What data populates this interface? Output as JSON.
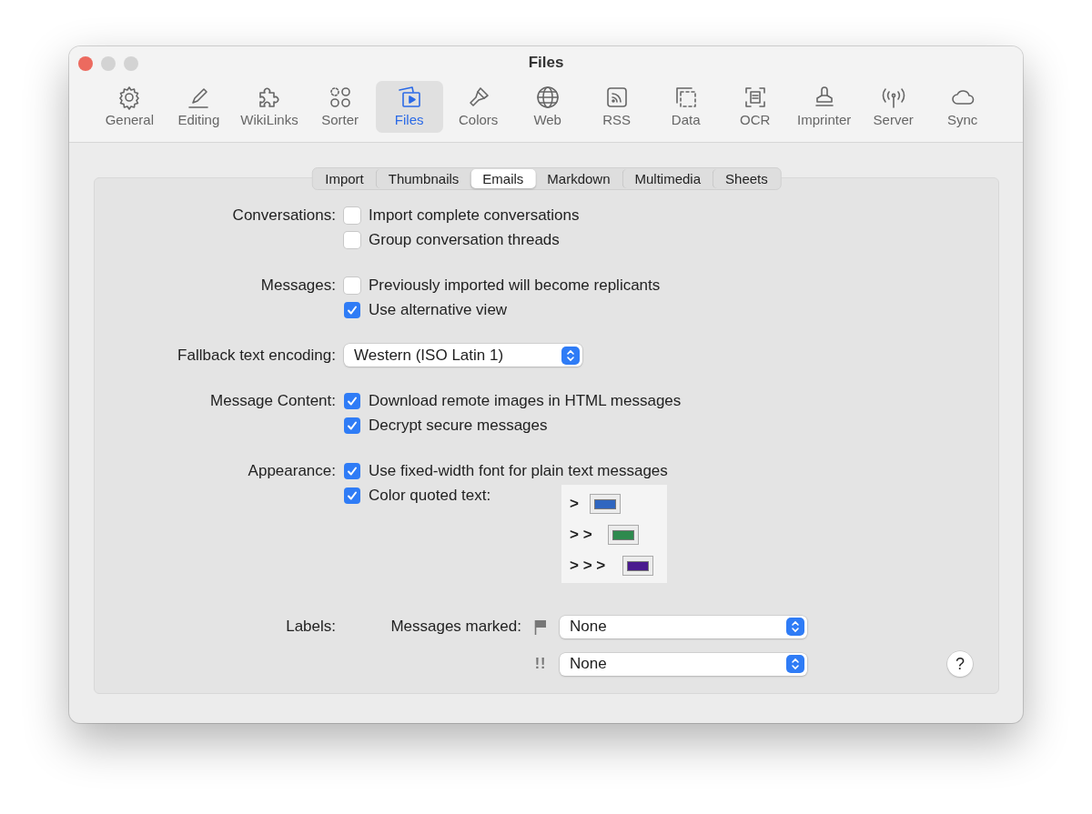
{
  "window": {
    "title": "Files"
  },
  "toolbar": [
    {
      "label": "General",
      "selected": false
    },
    {
      "label": "Editing",
      "selected": false
    },
    {
      "label": "WikiLinks",
      "selected": false
    },
    {
      "label": "Sorter",
      "selected": false
    },
    {
      "label": "Files",
      "selected": true
    },
    {
      "label": "Colors",
      "selected": false
    },
    {
      "label": "Web",
      "selected": false
    },
    {
      "label": "RSS",
      "selected": false
    },
    {
      "label": "Data",
      "selected": false
    },
    {
      "label": "OCR",
      "selected": false
    },
    {
      "label": "Imprinter",
      "selected": false
    },
    {
      "label": "Server",
      "selected": false
    },
    {
      "label": "Sync",
      "selected": false
    }
  ],
  "tabs": [
    {
      "label": "Import",
      "selected": false
    },
    {
      "label": "Thumbnails",
      "selected": false
    },
    {
      "label": "Emails",
      "selected": true
    },
    {
      "label": "Markdown",
      "selected": false
    },
    {
      "label": "Multimedia",
      "selected": false
    },
    {
      "label": "Sheets",
      "selected": false
    }
  ],
  "groups": [
    {
      "kind": "checkboxes",
      "label": "Conversations:",
      "options": [
        {
          "label": "Import complete conversations",
          "checked": false
        },
        {
          "label": "Group conversation threads",
          "checked": false
        }
      ]
    },
    {
      "kind": "checkboxes",
      "label": "Messages:",
      "options": [
        {
          "label": "Previously imported will become replicants",
          "checked": false
        },
        {
          "label": "Use alternative view",
          "checked": true
        }
      ]
    },
    {
      "kind": "popup",
      "label": "Fallback text encoding:",
      "value": "Western (ISO Latin 1)"
    },
    {
      "kind": "checkboxes",
      "label": "Message Content:",
      "options": [
        {
          "label": "Download remote images in HTML messages",
          "checked": true
        },
        {
          "label": "Decrypt secure messages",
          "checked": true
        }
      ]
    },
    {
      "kind": "checkboxes",
      "label": "Appearance:",
      "options": [
        {
          "label": "Use fixed-width font for plain text messages",
          "checked": true
        },
        {
          "label": "Color quoted text:",
          "checked": true
        }
      ],
      "quote_colors": [
        {
          "marker": ">",
          "color": "#2f66c0"
        },
        {
          "marker": "> >",
          "color": "#2e8a4e"
        },
        {
          "marker": "> > >",
          "color": "#4a1a8f"
        }
      ]
    },
    {
      "kind": "labels",
      "label": "Labels:",
      "rows": [
        {
          "kind": "flag",
          "label": "Messages marked:",
          "value": "None"
        },
        {
          "kind": "mark",
          "mark": "!!",
          "value": "None"
        }
      ]
    }
  ],
  "help": "?"
}
